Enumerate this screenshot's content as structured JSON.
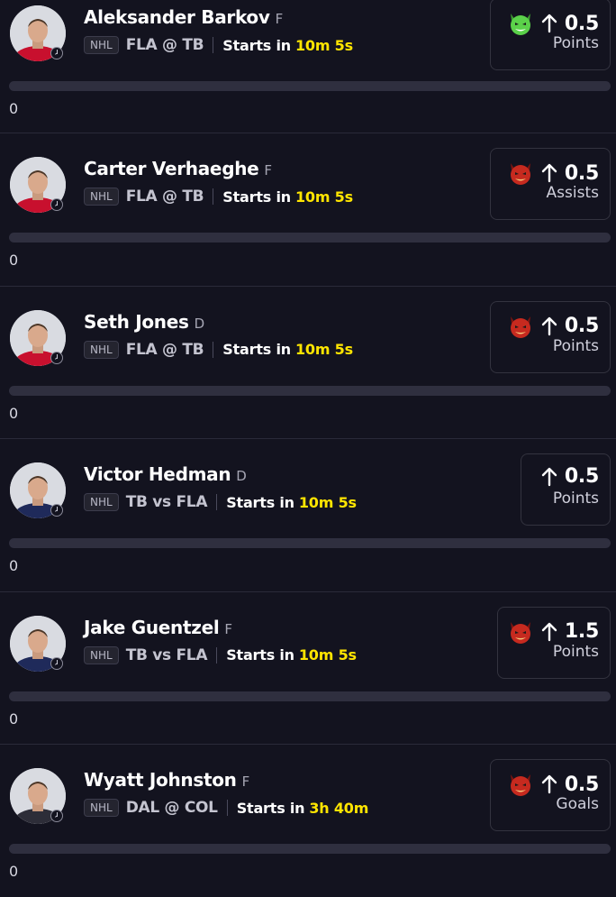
{
  "players": [
    {
      "name": "Aleksander Barkov",
      "position": "F",
      "league": "NHL",
      "matchup": "FLA @ TB",
      "starts_label": "Starts in",
      "starts_time": "10m 5s",
      "line": "0.5",
      "stat": "Points",
      "emoji": "green-devil",
      "count": "0",
      "jersey": "#c8102e"
    },
    {
      "name": "Carter Verhaeghe",
      "position": "F",
      "league": "NHL",
      "matchup": "FLA @ TB",
      "starts_label": "Starts in",
      "starts_time": "10m 5s",
      "line": "0.5",
      "stat": "Assists",
      "emoji": "red-devil",
      "count": "0",
      "jersey": "#c8102e"
    },
    {
      "name": "Seth Jones",
      "position": "D",
      "league": "NHL",
      "matchup": "FLA @ TB",
      "starts_label": "Starts in",
      "starts_time": "10m 5s",
      "line": "0.5",
      "stat": "Points",
      "emoji": "red-devil",
      "count": "0",
      "jersey": "#c8102e"
    },
    {
      "name": "Victor Hedman",
      "position": "D",
      "league": "NHL",
      "matchup": "TB vs FLA",
      "starts_label": "Starts in",
      "starts_time": "10m 5s",
      "line": "0.5",
      "stat": "Points",
      "emoji": "none",
      "count": "0",
      "jersey": "#1f2a5a"
    },
    {
      "name": "Jake Guentzel",
      "position": "F",
      "league": "NHL",
      "matchup": "TB vs FLA",
      "starts_label": "Starts in",
      "starts_time": "10m 5s",
      "line": "1.5",
      "stat": "Points",
      "emoji": "red-devil",
      "count": "0",
      "jersey": "#1f2a5a"
    },
    {
      "name": "Wyatt Johnston",
      "position": "F",
      "league": "NHL",
      "matchup": "DAL @ COL",
      "starts_label": "Starts in",
      "starts_time": "3h 40m",
      "line": "0.5",
      "stat": "Goals",
      "emoji": "red-devil",
      "count": "0",
      "jersey": "#2d2d38"
    }
  ],
  "colors": {
    "background": "#13131f",
    "highlight": "#ffe500",
    "border": "#33333f",
    "bar": "#2f2f3f"
  },
  "icons": {
    "arrow": "arrow-up-icon",
    "clock": "clock-icon",
    "green-devil": "green-devil-emoji-icon",
    "red-devil": "red-devil-emoji-icon"
  }
}
